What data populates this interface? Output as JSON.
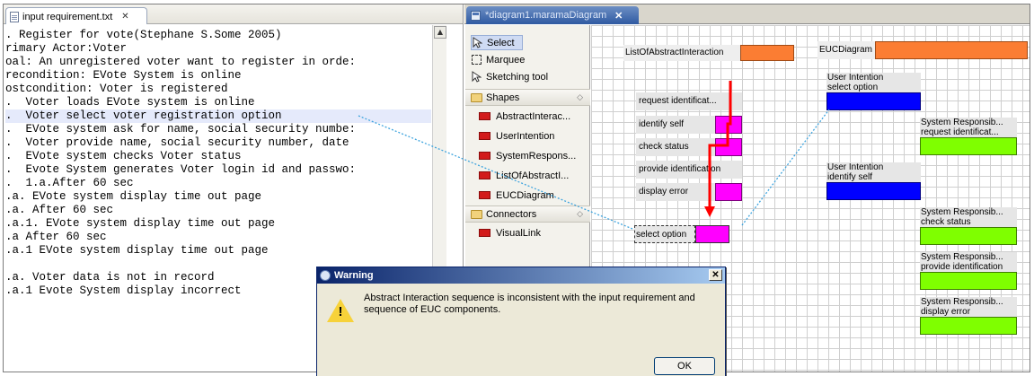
{
  "text_editor": {
    "tab_label": "input requirement.txt",
    "close_glyph": "✕",
    "lines": [
      ". Register for vote(Stephane S.Some 2005)",
      "rimary Actor:Voter",
      "oal: An unregistered voter want to register in orde:",
      "recondition: EVote System is online",
      "ostcondition: Voter is registered",
      ".  Voter loads EVote system is online",
      ".  Voter select voter registration option",
      ".  EVote system ask for name, social security numbe:",
      ".  Voter provide name, social security number, date",
      ".  EVote system checks Voter status",
      ".  Evote System generates Voter login id and passwo:",
      ".  1.a.After 60 sec",
      ".a. EVote system display time out page",
      ".a. After 60 sec",
      ".a.1. EVote system display time out page",
      ".a After 60 sec",
      ".a.1 EVote system display time out page",
      "",
      ".a. Voter data is not in record",
      ".a.1 Evote System display incorrect"
    ],
    "selected_line_index": 6
  },
  "diagram_editor": {
    "tab_label": "*diagram1.maramaDiagram",
    "close_glyph": "✕",
    "palette": {
      "tools": [
        {
          "label": "Select",
          "icon": "arrow-pointer-icon",
          "selected": true
        },
        {
          "label": "Marquee",
          "icon": "marquee-icon"
        },
        {
          "label": "Sketching tool",
          "icon": "arrow-pointer-icon"
        }
      ],
      "shapes_header": "Shapes",
      "shapes": [
        "AbstractInterac...",
        "UserIntention",
        "SystemRespons...",
        "ListOfAbstractI...",
        "EUCDiagram"
      ],
      "connectors_header": "Connectors",
      "connectors": [
        "VisualLink"
      ]
    },
    "canvas": {
      "list_title": "ListOfAbstractInteraction",
      "euc_title": "EUCDiagram",
      "interactions": [
        "request identificat...",
        "identify self",
        "check status",
        "provide identification",
        "display error",
        "select option"
      ],
      "user_intentions": [
        "User Intention\nselect option",
        "User Intention\nidentify self"
      ],
      "system_responsibilities": [
        "System Responsib...\nrequest identificat...",
        "System Responsib...\ncheck status",
        "System Responsib...\nprovide identification",
        "System Responsib...\ndisplay error"
      ],
      "colors": {
        "orange": "#fb7d33",
        "magenta": "#ff00ff",
        "blue": "#0000ff",
        "green": "#7fff00",
        "red_path": "#ff0000",
        "link": "#3ea4de"
      }
    }
  },
  "dialog": {
    "title": "Warning",
    "message": "Abstract Interaction sequence is inconsistent with the input requirement and sequence of EUC components.",
    "ok_label": "OK",
    "close_glyph": "✕"
  }
}
